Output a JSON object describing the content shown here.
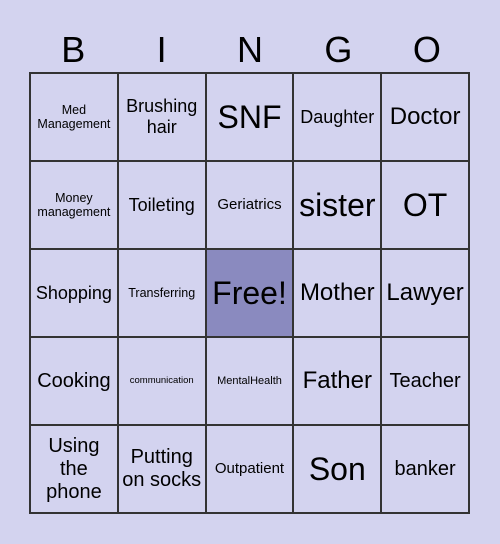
{
  "header": [
    "B",
    "I",
    "N",
    "G",
    "O"
  ],
  "cells": [
    [
      "Med Management",
      "Brushing hair",
      "SNF",
      "Daughter",
      "Doctor"
    ],
    [
      "Money management",
      "Toileting",
      "Geriatrics",
      "sister",
      "OT"
    ],
    [
      "Shopping",
      "Transferring",
      "Free!",
      "Mother",
      "Lawyer"
    ],
    [
      "Cooking",
      "communication",
      "MentalHealth",
      "Father",
      "Teacher"
    ],
    [
      "Using the phone",
      "Putting on socks",
      "Outpatient",
      "Son",
      "banker"
    ]
  ],
  "colors": {
    "background": "#d3d3ef",
    "free_cell": "#8a8abf"
  }
}
